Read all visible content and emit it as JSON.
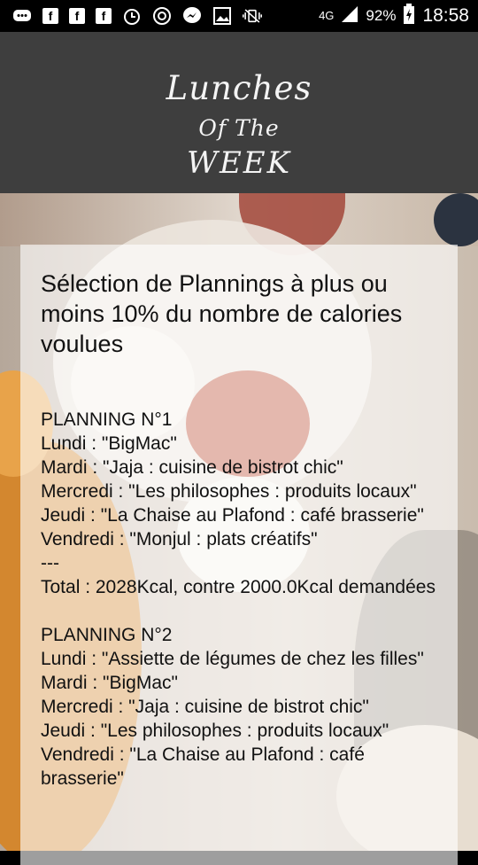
{
  "status_bar": {
    "network": "4G",
    "battery": "92%",
    "time": "18:58",
    "icons": [
      "message-icon",
      "facebook-icon",
      "facebook-icon",
      "facebook-icon",
      "alarm-icon",
      "sync-icon",
      "messenger-icon",
      "image-icon",
      "vibrate-icon",
      "signal-icon",
      "battery-icon"
    ]
  },
  "header": {
    "logo_line1": "Lunches",
    "logo_line2": "Of The",
    "logo_line3": "WEEK"
  },
  "card": {
    "title": "Sélection de Plannings à plus ou moins 10% du nombre de calories voulues",
    "plannings": [
      {
        "title": "PLANNING N°1",
        "days": [
          "Lundi : \"BigMac\"",
          "Mardi : \"Jaja : cuisine de bistrot chic\"",
          "Mercredi : \"Les philosophes : produits locaux\"",
          "Jeudi : \"La Chaise au Plafond : café brasserie\"",
          "Vendredi : \"Monjul : plats créatifs\""
        ],
        "separator": "---",
        "total": "Total : 2028Kcal, contre 2000.0Kcal demandées"
      },
      {
        "title": "PLANNING N°2",
        "days": [
          "Lundi : \"Assiette de légumes de chez les filles\"",
          "Mardi : \"BigMac\"",
          "Mercredi : \"Jaja : cuisine de bistrot chic\"",
          "Jeudi : \"Les philosophes : produits locaux\"",
          "Vendredi : \"La Chaise au Plafond : café brasserie\""
        ]
      }
    ]
  }
}
